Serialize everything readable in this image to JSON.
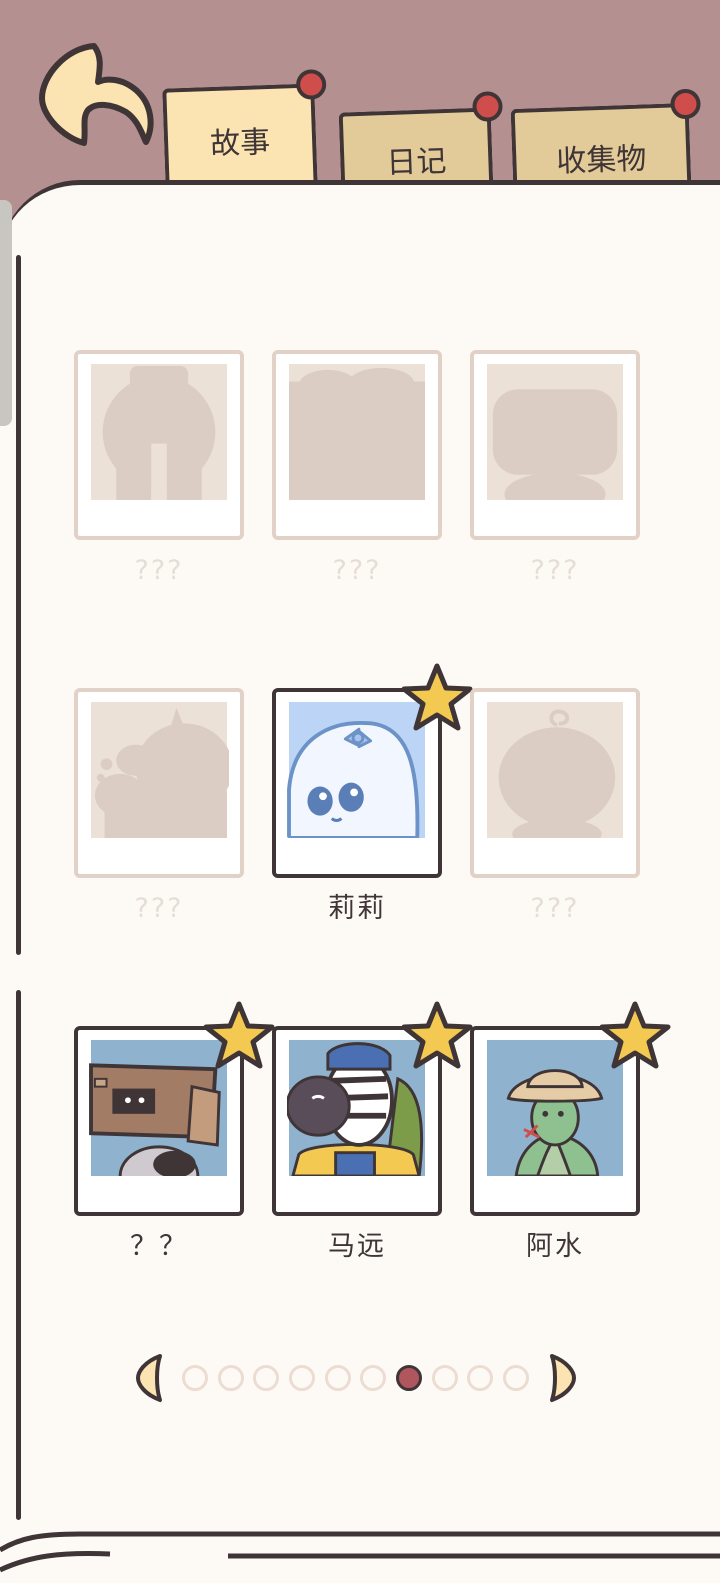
{
  "header": {
    "tabs": [
      {
        "label": "故事",
        "active": true
      },
      {
        "label": "日记",
        "active": false
      },
      {
        "label": "收集物",
        "active": false
      }
    ]
  },
  "colors": {
    "background_mauve": "#b59090",
    "page_cream": "#fdfaf5",
    "tab_active": "#fbe4b1",
    "tab_inactive": "#e2cb98",
    "pin_red": "#cf4e4c",
    "outline": "#3f3537",
    "locked_frame": "#e1d1c7",
    "star_yellow": "#f4c951"
  },
  "cards": [
    {
      "name": "???",
      "unlocked": false,
      "icon": "silhouette-hooded-figure"
    },
    {
      "name": "???",
      "unlocked": false,
      "icon": "silhouette-wide-creature"
    },
    {
      "name": "???",
      "unlocked": false,
      "icon": "silhouette-robot"
    },
    {
      "name": "???",
      "unlocked": false,
      "icon": "silhouette-bubble-creature"
    },
    {
      "name": "莉莉",
      "unlocked": true,
      "starred": true,
      "icon": "ghost-with-bow"
    },
    {
      "name": "???",
      "unlocked": false,
      "icon": "silhouette-round-head"
    },
    {
      "name": "？？",
      "unlocked": true,
      "starred": true,
      "icon": "cardboard-box-creature"
    },
    {
      "name": "马远",
      "unlocked": true,
      "starred": true,
      "icon": "zebra-with-backpack"
    },
    {
      "name": "阿水",
      "unlocked": true,
      "starred": true,
      "icon": "lizard-in-bucket-hat"
    }
  ],
  "pagination": {
    "total_pages": 10,
    "current_page": 7,
    "prev_icon": "prev-page-arrow",
    "next_icon": "next-page-arrow"
  }
}
